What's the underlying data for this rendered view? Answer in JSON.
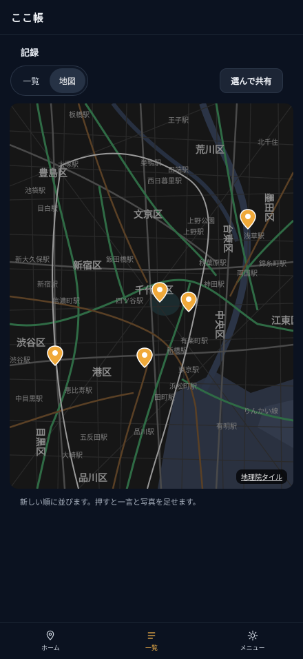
{
  "app": {
    "title": "ここ帳"
  },
  "section": {
    "label": "記録"
  },
  "view_toggle": {
    "options": [
      {
        "label": "一覧",
        "active": false
      },
      {
        "label": "地図",
        "active": true
      }
    ]
  },
  "share_button": {
    "label": "選んで共有"
  },
  "map": {
    "attribution": "地理院タイル",
    "labels": {
      "toshima": "豊島区",
      "bunkyo": "文京区",
      "arakawa": "荒川区",
      "taito": "台東区",
      "sumida": "墨田区",
      "shinjuku": "新宿区",
      "chiyoda": "千代田区",
      "chuo": "中央区",
      "koto": "江東区",
      "shibuya": "渋谷区",
      "minato": "港区",
      "meguro": "目黒区",
      "shinagawa": "品川区",
      "ikebukuro": "池袋駅",
      "otsuka": "大塚駅",
      "sugamo": "巣鴨駅",
      "mejiro": "目白駅",
      "ueno": "上野駅",
      "uenokoen": "上野公園",
      "asakusa": "浅草駅",
      "akihabara": "秋葉原駅",
      "tokyo": "東京駅",
      "iidabashi": "飯田橋駅",
      "yotsuya": "四ツ谷駅",
      "shinjuku_sta": "新宿駅",
      "shibuya_sta": "渋谷駅",
      "ebisu": "恵比寿駅",
      "nakameguro": "中目黒駅",
      "gotanda": "五反田駅",
      "osaki": "大崎駅",
      "shinagawa_sta": "品川駅",
      "tamachi": "田町駅",
      "hamamatsucho": "浜松町駅",
      "shimbashi": "新橋駅",
      "yurakucho": "有楽町駅",
      "kanda": "神田駅",
      "kinshicho": "錦糸町駅",
      "ryogoku": "両国駅",
      "nishinippori": "西日暮里駅",
      "tabata": "田端駅",
      "oji": "王子駅",
      "itabashi": "板橋駅",
      "shinokubo": "新大久保駅",
      "shinanomachi": "信濃町駅",
      "ariake": "有明駅",
      "kitasenju": "北千住",
      "ringo": "りんかい線"
    },
    "pins": [
      {
        "name": "pin-taito"
      },
      {
        "name": "pin-chiyoda"
      },
      {
        "name": "pin-akihabara"
      },
      {
        "name": "pin-shibuya"
      },
      {
        "name": "pin-minato"
      }
    ]
  },
  "hint": "新しい順に並びます。押すと一言と写真を足せます。",
  "bottom_nav": {
    "items": [
      {
        "label": "ホーム",
        "icon": "map-pin-icon",
        "active": false
      },
      {
        "label": "一覧",
        "icon": "list-icon",
        "active": true
      },
      {
        "label": "メニュー",
        "icon": "sun-icon",
        "active": false
      }
    ]
  },
  "colors": {
    "accent": "#f2b24a",
    "background": "#0b1220",
    "pin": "#f0a93a"
  }
}
